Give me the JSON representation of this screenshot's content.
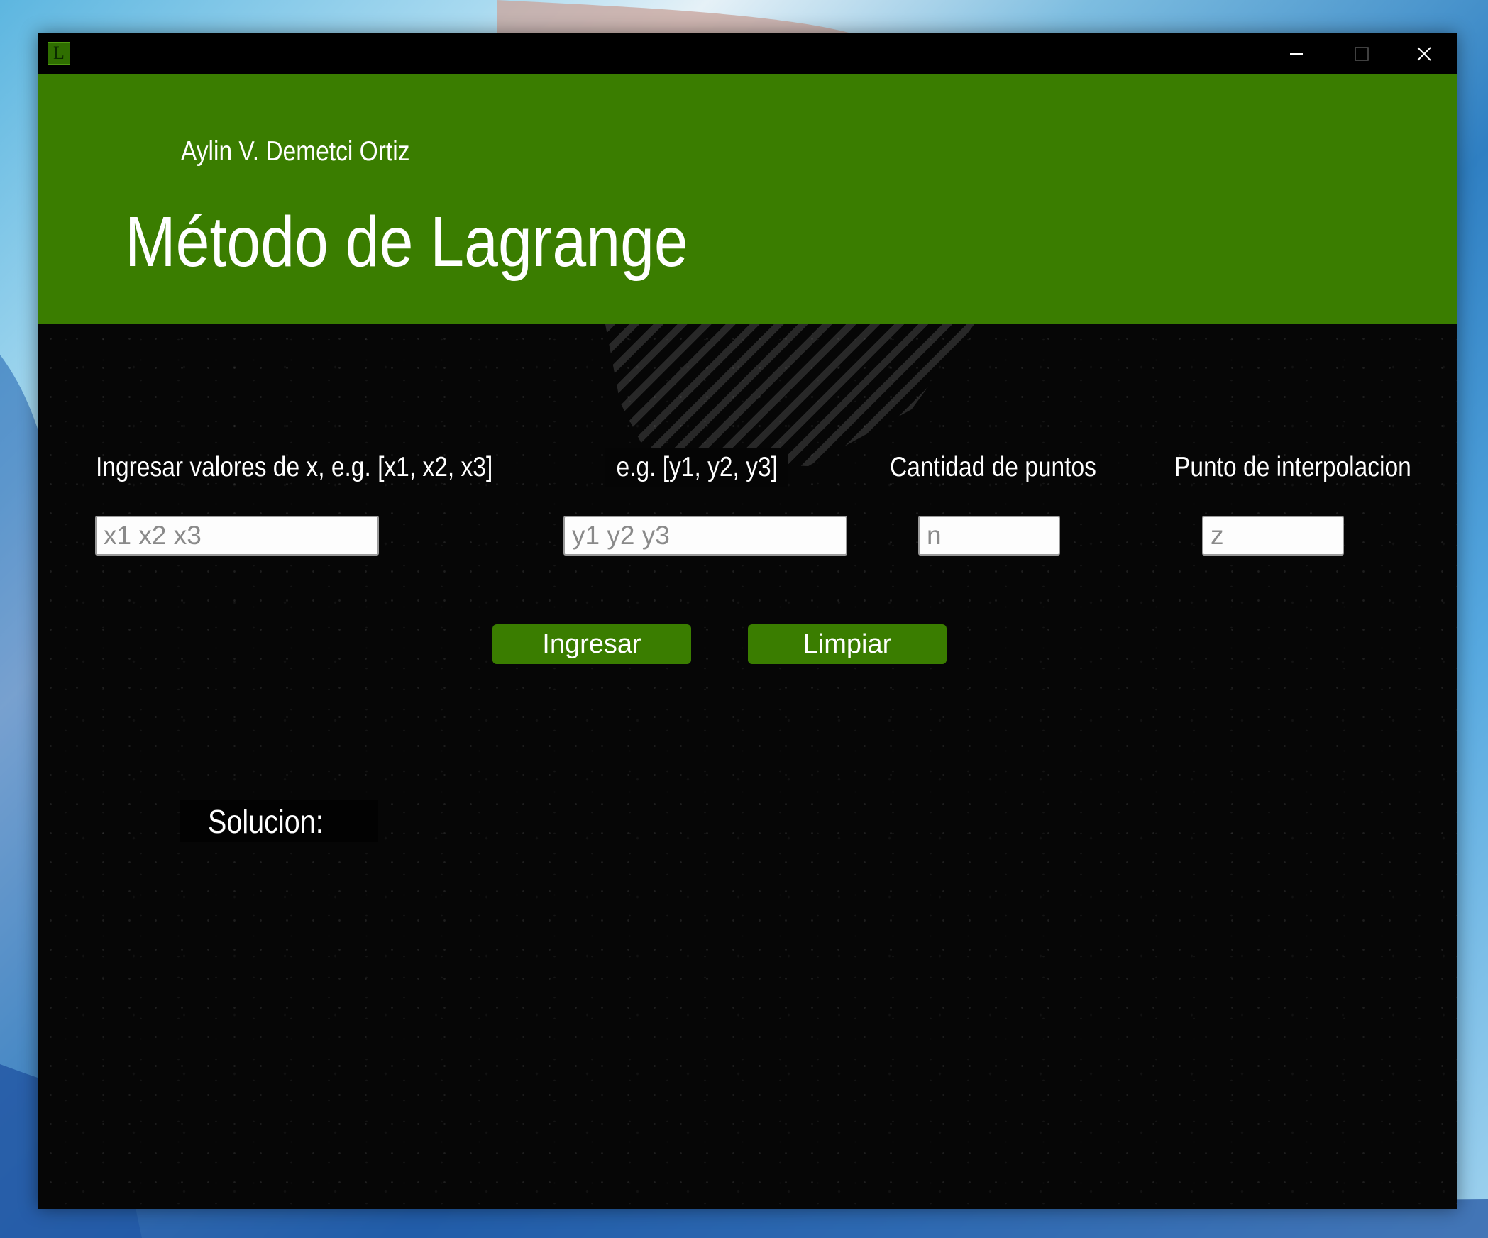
{
  "window": {
    "icon_letter": "L"
  },
  "header": {
    "author": "Aylin V. Demetci Ortiz",
    "title": "Método de Lagrange"
  },
  "form": {
    "x_label": "Ingresar valores de x, e.g. [x1, x2, x3]",
    "y_label": "e.g. [y1, y2, y3]",
    "n_label": "Cantidad de puntos",
    "z_label": "Punto de interpolacion",
    "x_placeholder": "x1 x2 x3",
    "y_placeholder": "y1 y2 y3",
    "n_placeholder": "n",
    "z_placeholder": "z",
    "x_value": "",
    "y_value": "",
    "n_value": "",
    "z_value": ""
  },
  "buttons": {
    "ingresar": "Ingresar",
    "limpiar": "Limpiar"
  },
  "result": {
    "label": "Solucion:"
  },
  "colors": {
    "accent": "#3a7d00",
    "background": "#060606",
    "titlebar": "#000000",
    "text": "#ffffff"
  },
  "icons": [
    "app-icon",
    "minimize-icon",
    "maximize-icon",
    "close-icon"
  ]
}
